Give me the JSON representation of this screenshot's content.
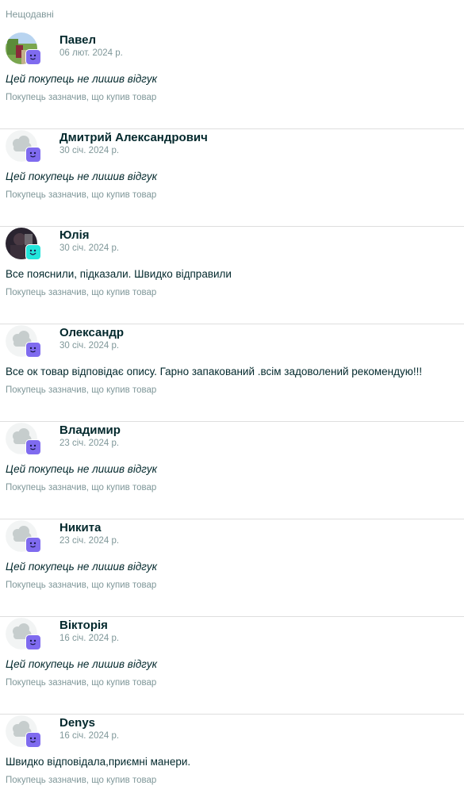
{
  "section_title": "Нещодавні",
  "note_text": "Покупець зазначив, що купив товар",
  "reviews": [
    {
      "name": "Павел",
      "date": "06 лют. 2024 р.",
      "text": "Цей покупець не лишив відгук",
      "avatar": "photo-landscape",
      "badge": "purple-smile-badge"
    },
    {
      "name": "Дмитрий Александрович",
      "date": "30 січ. 2024 р.",
      "text": "Цей покупець не лишив відгук",
      "avatar": "default-cloud-avatar",
      "badge": "purple-smile-badge"
    },
    {
      "name": "Юлія",
      "date": "30 січ. 2024 р.",
      "text": "Все пояснили, підказали. Швидко відправили",
      "avatar": "photo-dark",
      "badge": "teal-smile-badge"
    },
    {
      "name": "Олександр",
      "date": "30 січ. 2024 р.",
      "text": "Все ок товар відповідає опису. Гарно запакований .всім задоволений рекомендую!!!",
      "avatar": "default-cloud-avatar",
      "badge": "purple-smile-badge"
    },
    {
      "name": "Владимир",
      "date": "23 січ. 2024 р.",
      "text": "Цей покупець не лишив відгук",
      "avatar": "default-cloud-avatar",
      "badge": "purple-smile-badge"
    },
    {
      "name": "Никита",
      "date": "23 січ. 2024 р.",
      "text": "Цей покупець не лишив відгук",
      "avatar": "default-cloud-avatar",
      "badge": "purple-smile-badge"
    },
    {
      "name": "Вікторія",
      "date": "16 січ. 2024 р.",
      "text": "Цей покупець не лишив відгук",
      "avatar": "default-cloud-avatar",
      "badge": "purple-smile-badge"
    },
    {
      "name": "Denys",
      "date": "16 січ. 2024 р.",
      "text": "Швидко відповідала,приємні манери.",
      "avatar": "default-cloud-avatar",
      "badge": "purple-smile-badge"
    }
  ],
  "colors": {
    "text_primary": "#02282c",
    "text_secondary": "#7f9799",
    "divider": "#dedede",
    "badge_purple": "#7f6bef",
    "badge_teal": "#23e5db"
  }
}
